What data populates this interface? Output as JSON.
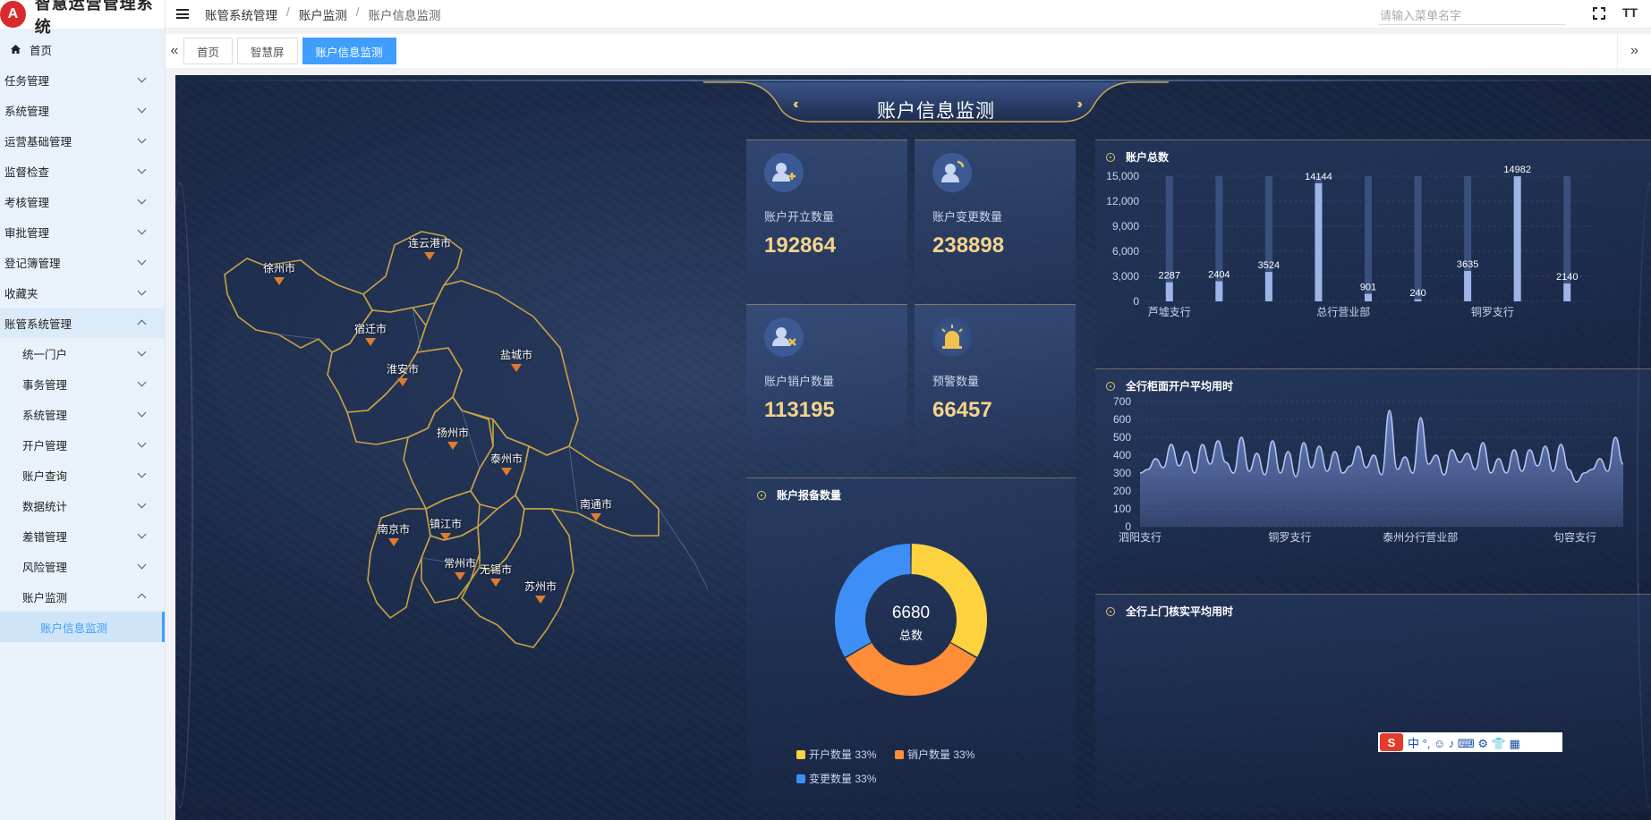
{
  "app": {
    "title": "智慧运营管理系统",
    "logo_char": "A"
  },
  "sidebar": {
    "home": "首页",
    "items": [
      {
        "label": "任务管理"
      },
      {
        "label": "系统管理"
      },
      {
        "label": "运营基础管理"
      },
      {
        "label": "监督检查"
      },
      {
        "label": "考核管理"
      },
      {
        "label": "审批管理"
      },
      {
        "label": "登记簿管理"
      },
      {
        "label": "收藏夹"
      },
      {
        "label": "账管系统管理"
      }
    ],
    "sub_items": [
      {
        "label": "统一门户"
      },
      {
        "label": "事务管理"
      },
      {
        "label": "系统管理"
      },
      {
        "label": "开户管理"
      },
      {
        "label": "账户查询"
      },
      {
        "label": "数据统计"
      },
      {
        "label": "差错管理"
      },
      {
        "label": "风险管理"
      },
      {
        "label": "账户监测"
      }
    ],
    "leaf": "账户信息监测"
  },
  "breadcrumb": [
    "账管系统管理",
    "/",
    "账户监测",
    "/",
    "账户信息监测"
  ],
  "search": {
    "placeholder": "请输入菜单名字"
  },
  "topbar": {
    "font_icon": "TT"
  },
  "tabs": [
    "首页",
    "智慧屏",
    "账户信息监测"
  ],
  "dashboard": {
    "title": "账户信息监测",
    "kpis": [
      {
        "label": "账户开立数量",
        "value": "192864",
        "icon": "user-add-icon"
      },
      {
        "label": "账户变更数量",
        "value": "238898",
        "icon": "user-change-icon"
      },
      {
        "label": "账户销户数量",
        "value": "113195",
        "icon": "user-remove-icon"
      },
      {
        "label": "预警数量",
        "value": "66457",
        "icon": "alarm-icon"
      }
    ],
    "panels": {
      "total": "账户总数",
      "report": "账户报备数量",
      "counter": "全行柜面开户平均用时",
      "visit": "全行上门核实平均用时"
    },
    "donut": {
      "center_value": "6680",
      "center_label": "总数"
    },
    "map_cities": [
      {
        "name": "徐州市"
      },
      {
        "name": "连云港市"
      },
      {
        "name": "宿迁市"
      },
      {
        "name": "淮安市"
      },
      {
        "name": "盐城市"
      },
      {
        "name": "扬州市"
      },
      {
        "name": "泰州市"
      },
      {
        "name": "南通市"
      },
      {
        "name": "南京市"
      },
      {
        "name": "镇江市"
      },
      {
        "name": "常州市"
      },
      {
        "name": "无锡市"
      },
      {
        "name": "苏州市"
      }
    ]
  },
  "ime": {
    "chars": "中 °, ☺ ♪ ⌨ ⚙ 👕 ▦"
  },
  "chart_data": [
    {
      "type": "bar",
      "title": "账户总数",
      "categories": [
        "芦墟支行",
        "",
        "",
        "总行营业部",
        "",
        "",
        "铜罗支行",
        "",
        ""
      ],
      "tick_labels": [
        "芦墟支行",
        "总行营业部",
        "铜罗支行"
      ],
      "values": [
        2287,
        2404,
        3524,
        14144,
        901,
        240,
        3635,
        14982,
        2140
      ],
      "yticks": [
        0,
        3000,
        6000,
        9000,
        12000,
        15000
      ],
      "ytick_labels": [
        "0",
        "3,000",
        "6,000",
        "9,000",
        "12,000",
        "15,000"
      ],
      "ylim": [
        0,
        15000
      ],
      "colors": {
        "bar": "#9fb4e6",
        "track": "#3a4f7e"
      }
    },
    {
      "type": "area",
      "title": "全行柜面开户平均用时",
      "x_labels": [
        "泗阳支行",
        "铜罗支行",
        "泰州分行营业部",
        "句容支行"
      ],
      "yticks": [
        0,
        100,
        200,
        300,
        400,
        500,
        600,
        700
      ],
      "ylim": [
        0,
        700
      ],
      "values": [
        300,
        320,
        380,
        330,
        460,
        340,
        420,
        300,
        460,
        350,
        480,
        360,
        300,
        500,
        310,
        410,
        290,
        480,
        300,
        420,
        280,
        470,
        330,
        450,
        310,
        420,
        300,
        340,
        450,
        330,
        400,
        290,
        650,
        320,
        390,
        300,
        610,
        350,
        400,
        290,
        430,
        360,
        410,
        320,
        470,
        300,
        380,
        300,
        430,
        310,
        430,
        340,
        450,
        310,
        460,
        320,
        250,
        300,
        320,
        380,
        310,
        500,
        350
      ],
      "colors": {
        "line": "#b7c7f5",
        "fill": "#6f86c9"
      }
    },
    {
      "type": "pie",
      "title": "账户报备数量",
      "categories": [
        "开户数量",
        "销户数量",
        "变更数量"
      ],
      "values": [
        33.3,
        33.3,
        33.3
      ],
      "legend_labels": [
        "33%",
        "33%",
        "33%"
      ],
      "colors": [
        "#fcd23f",
        "#ff8c37",
        "#3d8ef5"
      ]
    }
  ]
}
